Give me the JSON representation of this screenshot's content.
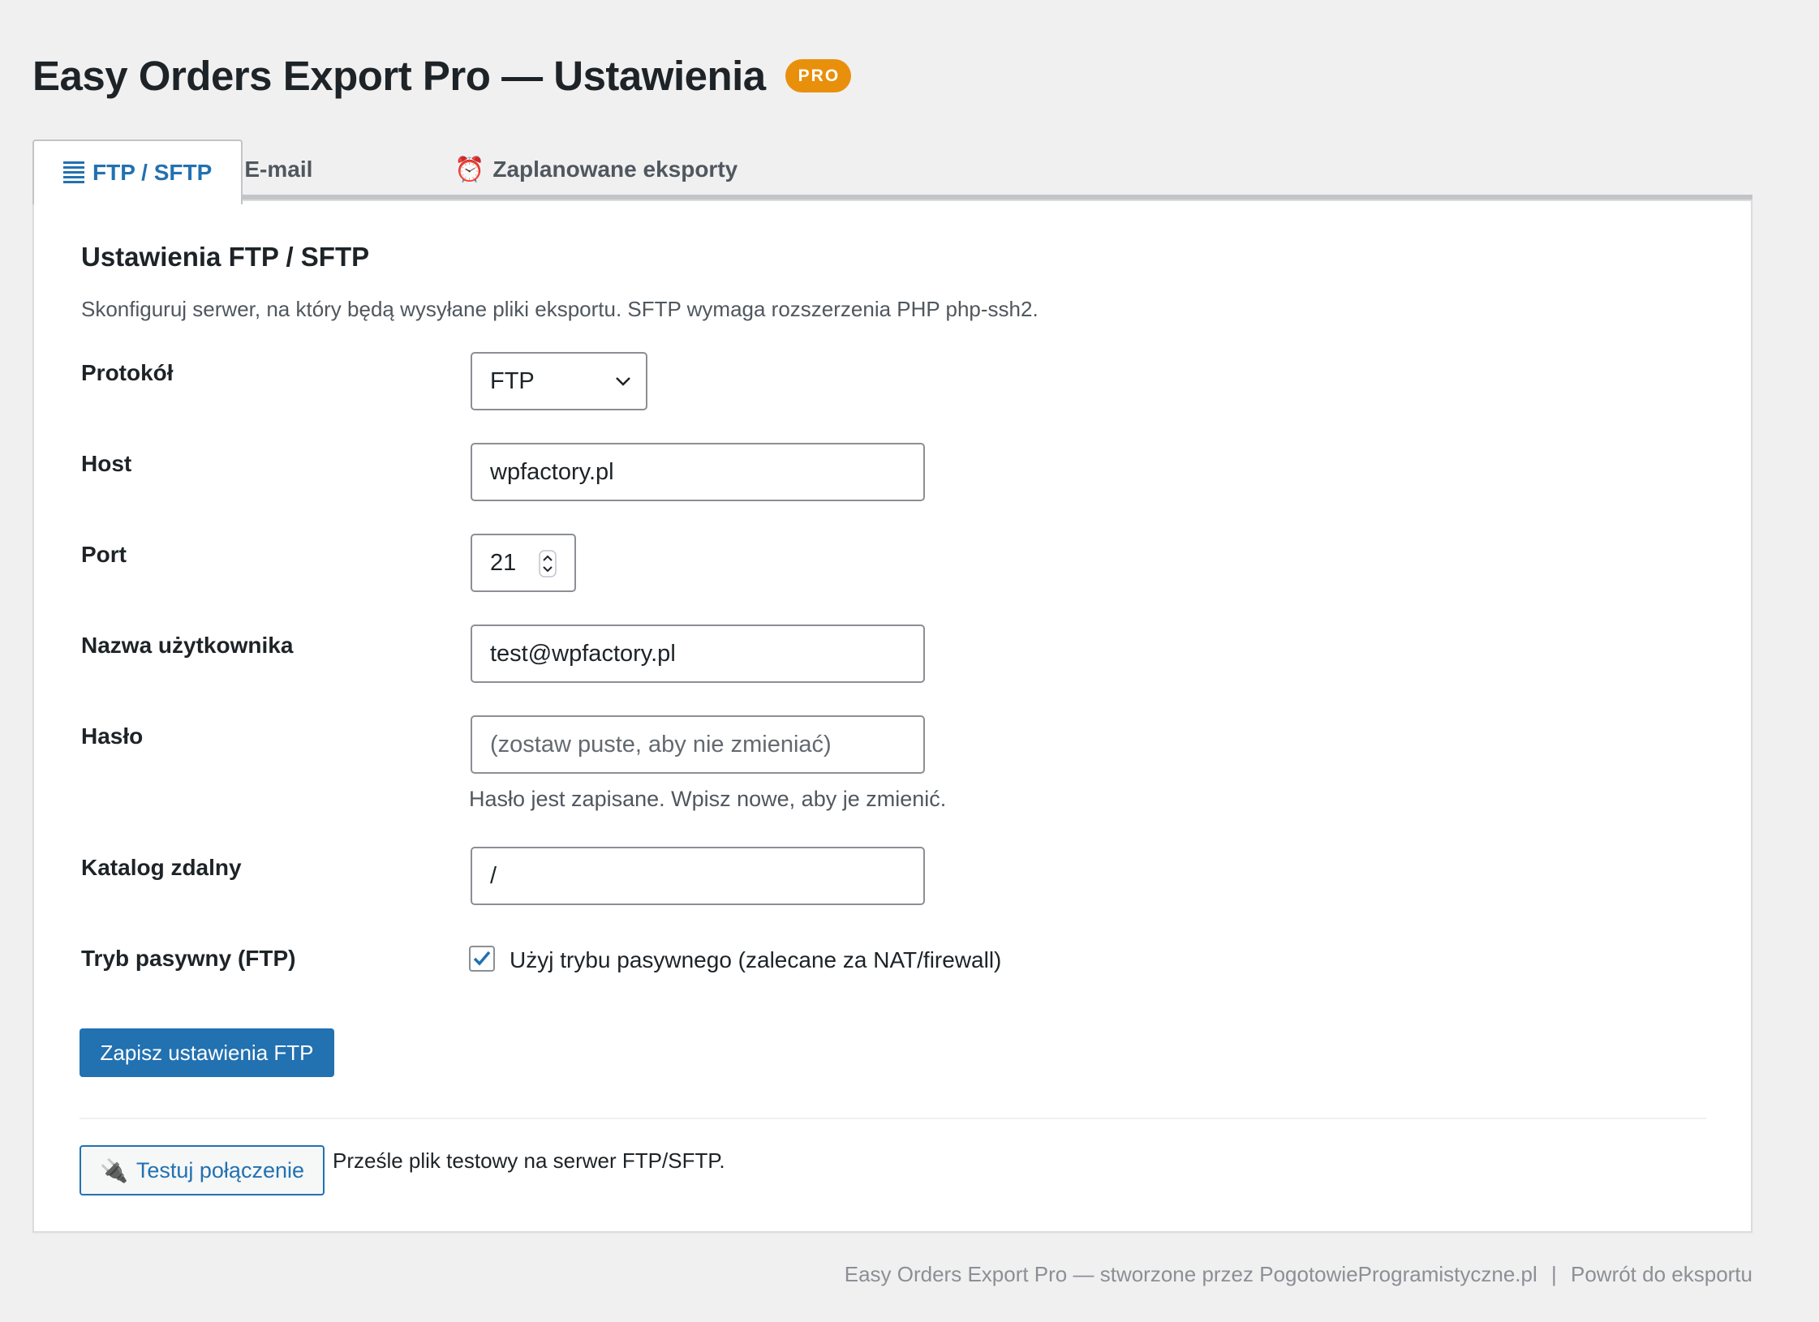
{
  "header": {
    "title": "Easy Orders Export Pro — Ustawienia",
    "badge": "PRO"
  },
  "tabs": [
    {
      "label": "FTP / SFTP",
      "icon": "list-icon",
      "active": true
    },
    {
      "label": "E-mail",
      "icon": "envelope-icon",
      "glyph": "📧",
      "active": false
    },
    {
      "label": "Zaplanowane eksporty",
      "icon": "alarm-clock-icon",
      "glyph": "⏰",
      "active": false
    }
  ],
  "section": {
    "title": "Ustawienia FTP / SFTP",
    "description": "Skonfiguruj serwer, na który będą wysyłane pliki eksportu. SFTP wymaga rozszerzenia PHP php-ssh2."
  },
  "form": {
    "protocol": {
      "label": "Protokół",
      "value": "FTP"
    },
    "host": {
      "label": "Host",
      "value": "wpfactory.pl"
    },
    "port": {
      "label": "Port",
      "value": "21"
    },
    "username": {
      "label": "Nazwa użytkownika",
      "value": "test@wpfactory.pl"
    },
    "password": {
      "label": "Hasło",
      "placeholder": "(zostaw puste, aby nie zmieniać)",
      "hint": "Hasło jest zapisane. Wpisz nowe, aby je zmienić."
    },
    "remote_dir": {
      "label": "Katalog zdalny",
      "value": "/"
    },
    "passive": {
      "label": "Tryb pasywny (FTP)",
      "checkbox_label": "Użyj trybu pasywnego (zalecane za NAT/firewall)",
      "checked": true
    }
  },
  "buttons": {
    "save": "Zapisz ustawienia FTP",
    "test": "Testuj połączenie",
    "test_icon": "🔌",
    "test_note": "Prześle plik testowy na serwer FTP/SFTP."
  },
  "footer": {
    "credit": "Easy Orders Export Pro — stworzone przez PogotowieProgramistyczne.pl",
    "separator": "|",
    "back_link": "Powrót do eksportu"
  },
  "colors": {
    "accent": "#2271b1",
    "badge": "#e8900c",
    "background": "#f0f0f1"
  }
}
